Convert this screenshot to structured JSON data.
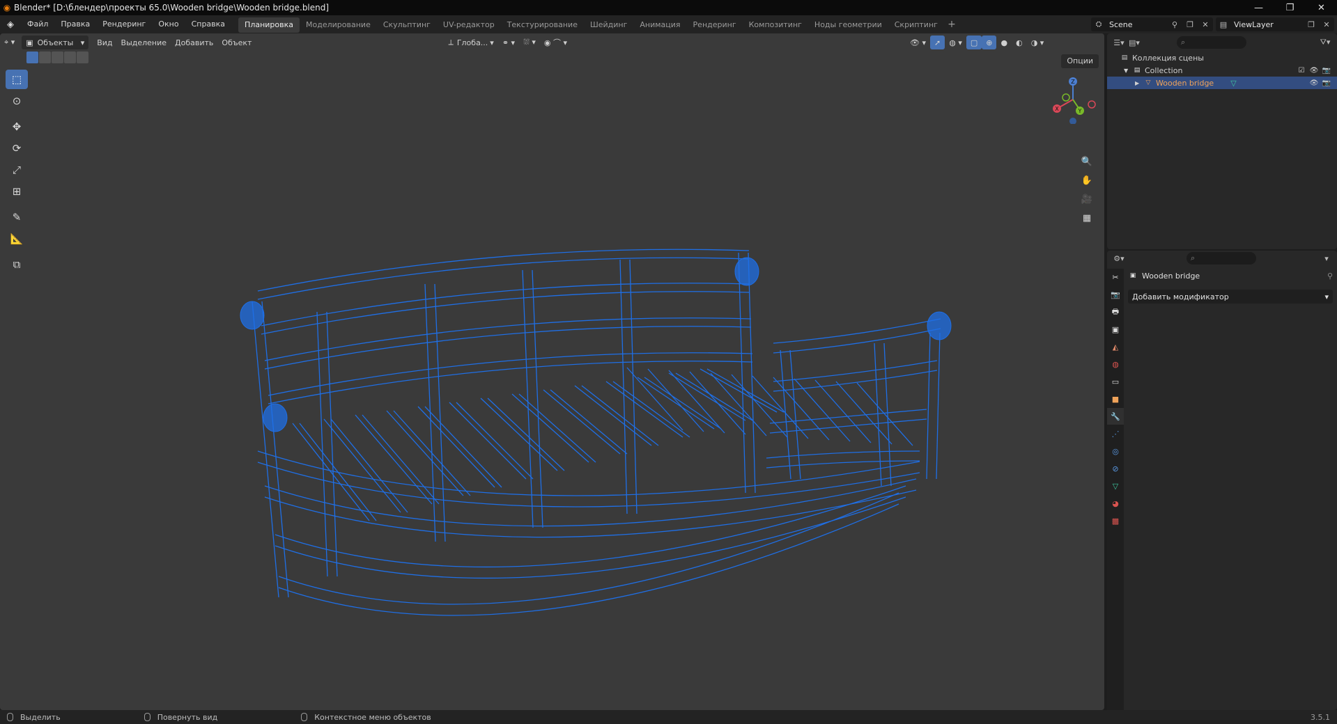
{
  "title": {
    "text": "Blender* [D:\\блендер\\проекты 65.0\\Wooden bridge\\Wooden bridge.blend]",
    "min": "—",
    "restore": "❐",
    "close": "✕"
  },
  "menu": {
    "items": [
      "Файл",
      "Правка",
      "Рендеринг",
      "Окно",
      "Справка"
    ],
    "workspaces": [
      "Планировка",
      "Моделирование",
      "Скульптинг",
      "UV-редактор",
      "Текстурирование",
      "Шейдинг",
      "Анимация",
      "Рендеринг",
      "Композитинг",
      "Ноды геометрии",
      "Скриптинг"
    ],
    "active_workspace_index": 0,
    "add_label": "+",
    "scene": "Scene",
    "view_layer": "ViewLayer"
  },
  "viewport": {
    "mode": "Объекты",
    "menus": [
      "Вид",
      "Выделение",
      "Добавить",
      "Объект"
    ],
    "transform_orientation": "Глоба...",
    "options_label": "Опции",
    "gizmo": {
      "x": "X",
      "y": "Y",
      "z": "Z"
    },
    "wire_color": "#1f6fe6"
  },
  "outliner": {
    "scene_collection": "Коллекция сцены",
    "collection": "Collection",
    "object": "Wooden bridge"
  },
  "properties": {
    "object_name": "Wooden bridge",
    "add_modifier": "Добавить модификатор"
  },
  "status": {
    "select": "Выделить",
    "rotate": "Повернуть вид",
    "context": "Контекстное меню объектов",
    "version": "3.5.1"
  }
}
